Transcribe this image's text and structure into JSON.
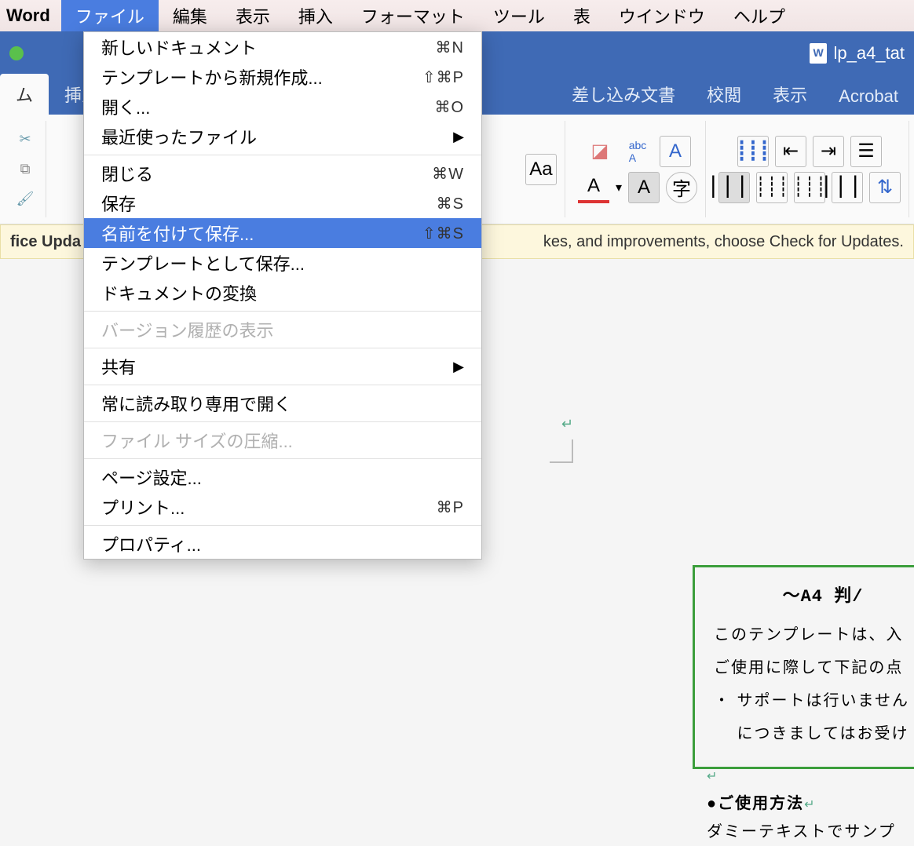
{
  "menubar": {
    "app": "Word",
    "items": [
      "ファイル",
      "編集",
      "表示",
      "挿入",
      "フォーマット",
      "ツール",
      "表",
      "ウインドウ",
      "ヘルプ"
    ],
    "active_index": 0
  },
  "window": {
    "doc_title": "lp_a4_tat"
  },
  "ribbon": {
    "tabs": [
      "ム",
      "挿入",
      "差し込み文書",
      "校閲",
      "表示",
      "Acrobat"
    ],
    "active_index": 0
  },
  "toolbar_icons": {
    "scissors": "✂",
    "copy": "⧉",
    "brush": "🖌",
    "aa": "Aa",
    "eraser": "◧",
    "abc": "abc",
    "a_box": "A",
    "ruby": "字",
    "underline_a": "A",
    "shade_a": "A"
  },
  "update_bar": {
    "left": "fice Upda",
    "right": "kes, and improvements, choose Check for Updates."
  },
  "dropdown": {
    "items": [
      {
        "label": "新しいドキュメント",
        "shortcut": "⌘N"
      },
      {
        "label": "テンプレートから新規作成...",
        "shortcut": "⇧⌘P"
      },
      {
        "label": "開く...",
        "shortcut": "⌘O"
      },
      {
        "label": "最近使ったファイル",
        "submenu": true
      },
      {
        "sep": true
      },
      {
        "label": "閉じる",
        "shortcut": "⌘W"
      },
      {
        "label": "保存",
        "shortcut": "⌘S"
      },
      {
        "label": "名前を付けて保存...",
        "shortcut": "⇧⌘S",
        "selected": true
      },
      {
        "label": "テンプレートとして保存..."
      },
      {
        "label": "ドキュメントの変換"
      },
      {
        "sep": true
      },
      {
        "label": "バージョン履歴の表示",
        "disabled": true
      },
      {
        "sep": true
      },
      {
        "label": "共有",
        "submenu": true
      },
      {
        "sep": true
      },
      {
        "label": "常に読み取り専用で開く"
      },
      {
        "sep": true
      },
      {
        "label": "ファイル サイズの圧縮...",
        "disabled": true
      },
      {
        "sep": true
      },
      {
        "label": "ページ設定..."
      },
      {
        "label": "プリント...",
        "shortcut": "⌘P"
      },
      {
        "sep": true
      },
      {
        "label": "プロパティ..."
      }
    ]
  },
  "document": {
    "frame_title": "〜A4 判/",
    "frame_l1": "このテンプレートは、入",
    "frame_l2": "ご使用に際して下記の点",
    "frame_b1": "・ サポートは行いません",
    "frame_b2": "　 につきましてはお受け",
    "section_hdr": "●ご使用方法",
    "section_l1": "ダミーテキストでサンプ"
  }
}
